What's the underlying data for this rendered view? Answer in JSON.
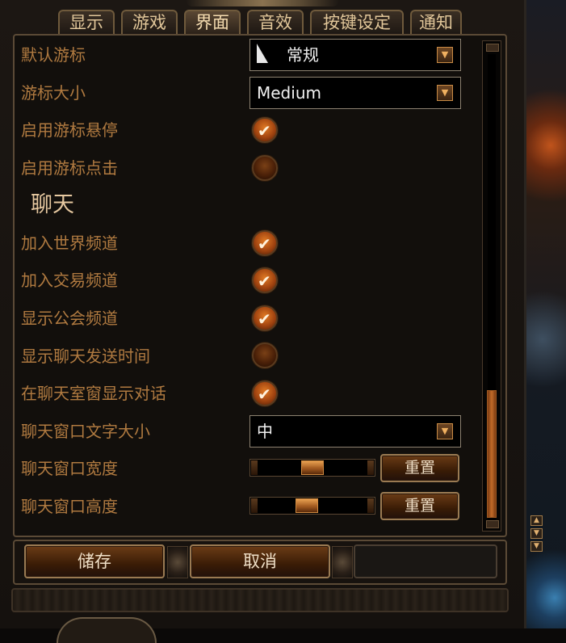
{
  "tabs": [
    {
      "label": "显示",
      "active": false
    },
    {
      "label": "游戏",
      "active": false
    },
    {
      "label": "界面",
      "active": true
    },
    {
      "label": "音效",
      "active": false
    },
    {
      "label": "按键设定",
      "active": false
    },
    {
      "label": "通知",
      "active": false
    }
  ],
  "settings": {
    "default_cursor": {
      "label": "默认游标",
      "value": "常规"
    },
    "cursor_size": {
      "label": "游标大小",
      "value": "Medium"
    },
    "cursor_hover": {
      "label": "启用游标悬停",
      "checked": true
    },
    "cursor_click": {
      "label": "启用游标点击",
      "checked": false
    }
  },
  "chat": {
    "section_title": "聊天",
    "join_world": {
      "label": "加入世界频道",
      "checked": true
    },
    "join_trade": {
      "label": "加入交易频道",
      "checked": true
    },
    "show_guild": {
      "label": "显示公会频道",
      "checked": true
    },
    "show_timestamp": {
      "label": "显示聊天发送时间",
      "checked": false
    },
    "show_dialog": {
      "label": "在聊天室窗显示对话",
      "checked": true
    },
    "font_size": {
      "label": "聊天窗口文字大小",
      "value": "中"
    },
    "width": {
      "label": "聊天窗口宽度",
      "level": 0.5,
      "reset_label": "重置"
    },
    "height": {
      "label": "聊天窗口高度",
      "level": 0.43,
      "reset_label": "重置"
    }
  },
  "scroll": {
    "position": "bottom"
  },
  "buttons": {
    "save": "储存",
    "cancel": "取消"
  },
  "icons": {
    "dropdown_arrow": "chevron-down-icon",
    "checkmark": "checkmark-icon",
    "cursor": "cursor-arrow-icon"
  },
  "colors": {
    "label": "#b07a40",
    "accent": "#d0782a",
    "tab_text": "#e2c79a"
  }
}
